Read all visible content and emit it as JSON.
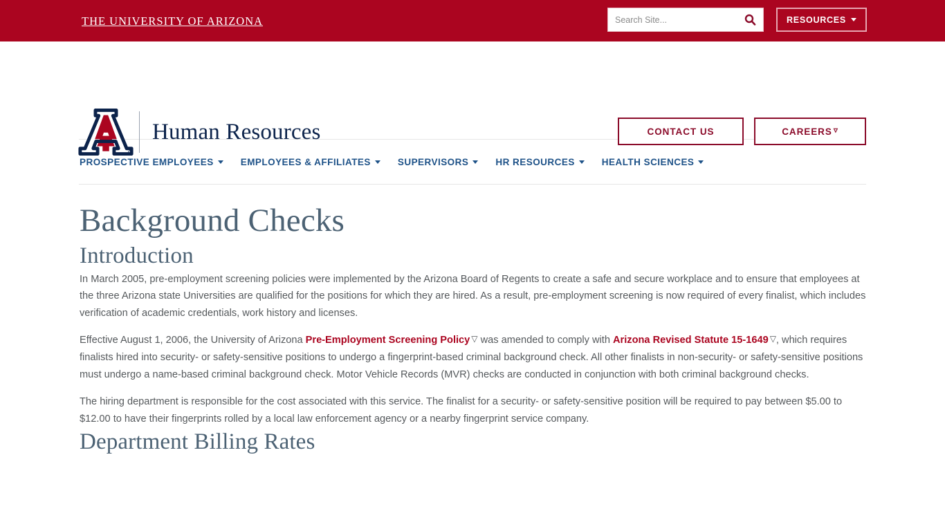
{
  "topbar": {
    "wordmark": "The University of Arizona",
    "search": {
      "placeholder": "Search Site...",
      "value": "",
      "icon": "search-icon"
    },
    "resources_label": "RESOURCES",
    "resources_caret_icon": "chevron-down-icon",
    "background_color": "#ab0520"
  },
  "masthead": {
    "logo_icon": "arizona-block-a-logo",
    "site_title": "Human Resources",
    "buttons": [
      {
        "label": "CONTACT US",
        "external": false
      },
      {
        "label": "CAREERS",
        "external": true,
        "icon": "external-link-icon"
      }
    ],
    "title_color": "#0c234b",
    "button_color": "#8b0b2a"
  },
  "nav": {
    "items": [
      {
        "label": "PROSPECTIVE EMPLOYEES",
        "has_dropdown": true
      },
      {
        "label": "EMPLOYEES & AFFILIATES",
        "has_dropdown": true
      },
      {
        "label": "SUPERVISORS",
        "has_dropdown": true
      },
      {
        "label": "HR RESOURCES",
        "has_dropdown": true
      },
      {
        "label": "HEALTH SCIENCES",
        "has_dropdown": true
      }
    ],
    "color": "#1e5288"
  },
  "main": {
    "page_title": "Background Checks",
    "sections": [
      {
        "heading": "Introduction",
        "paragraphs": [
          {
            "parts": [
              {
                "type": "text",
                "text": "In March 2005, pre-employment screening policies were implemented by the Arizona Board of Regents to create a safe and secure workplace and to ensure that employees at the three Arizona state Universities are qualified for the positions for which they are hired. As a result, pre-employment screening is now required of every finalist, which includes verification of academic credentials, work history and licenses."
              }
            ]
          },
          {
            "parts": [
              {
                "type": "text",
                "text": "Effective August 1, 2006, the University of Arizona "
              },
              {
                "type": "link",
                "text": "Pre-Employment Screening Policy",
                "external": true
              },
              {
                "type": "text",
                "text": " was amended to comply with "
              },
              {
                "type": "link",
                "text": "Arizona Revised Statute 15-1649",
                "external": true
              },
              {
                "type": "text",
                "text": ", which requires finalists hired into security- or safety-sensitive positions to undergo a fingerprint-based criminal background check. All other finalists in non-security- or safety-sensitive positions must undergo a name-based criminal background check. Motor Vehicle Records (MVR) checks are conducted in conjunction with both criminal background checks."
              }
            ]
          },
          {
            "parts": [
              {
                "type": "text",
                "text": "The hiring department is responsible for the cost associated with this service. The finalist for a security- or safety-sensitive position will be required to pay between $5.00 to $12.00 to have their fingerprints rolled by a local law enforcement agency or a nearby fingerprint service company."
              }
            ]
          }
        ]
      },
      {
        "heading": "Department Billing Rates",
        "paragraphs": []
      }
    ],
    "heading_color": "#4c6274",
    "text_color": "#55595c",
    "link_color": "#ab0520"
  }
}
